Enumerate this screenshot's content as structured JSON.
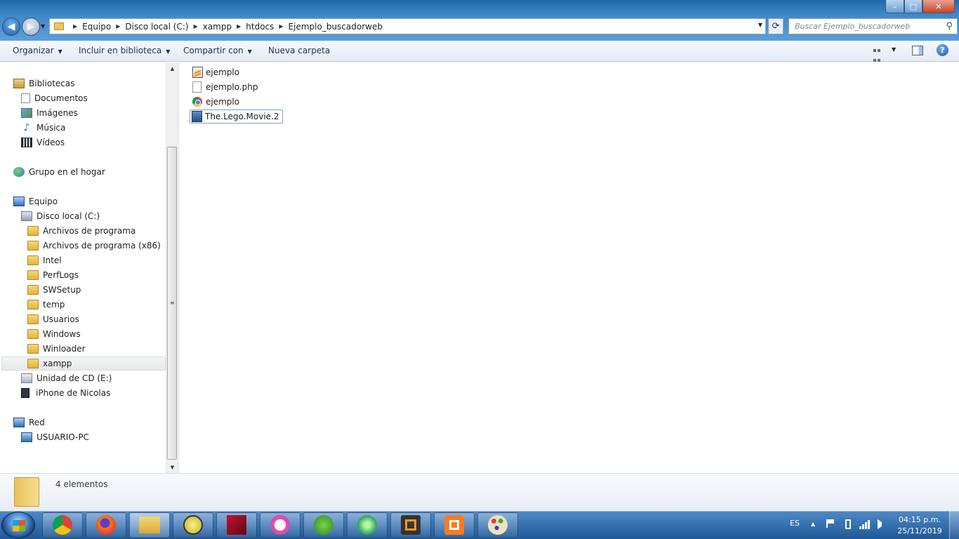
{
  "window": {
    "minimize": "–",
    "maximize": "□",
    "close": "✕"
  },
  "address": {
    "crumbs": [
      "Equipo",
      "Disco local (C:)",
      "xampp",
      "htdocs",
      "Ejemplo_buscadorweb"
    ]
  },
  "search": {
    "placeholder": "Buscar Ejemplo_buscadorweb"
  },
  "toolbar": {
    "organize": "Organizar",
    "include_library": "Incluir en biblioteca",
    "share": "Compartir con",
    "new_folder": "Nueva carpeta"
  },
  "nav": {
    "libraries": "Bibliotecas",
    "documents": "Documentos",
    "images": "Imágenes",
    "music": "Música",
    "videos": "Vídeos",
    "homegroup": "Grupo en el hogar",
    "computer": "Equipo",
    "local_disk": "Disco local (C:)",
    "folders": [
      "Archivos de programa",
      "Archivos de programa (x86)",
      "Intel",
      "PerfLogs",
      "SWSetup",
      "temp",
      "Usuarios",
      "Windows",
      "Winloader",
      "xampp"
    ],
    "cd_drive": "Unidad de CD (E:)",
    "iphone": "iPhone de Nicolas",
    "network": "Red",
    "network_pc": "USUARIO-PC"
  },
  "files": [
    {
      "name": "ejemplo",
      "icon": "sublime-file-icon"
    },
    {
      "name": "ejemplo.php",
      "icon": "blank-file-icon"
    },
    {
      "name": "ejemplo",
      "icon": "chrome-html-icon"
    },
    {
      "name": "The.Lego.Movie.2",
      "icon": "movie-file-icon"
    }
  ],
  "details": {
    "count": "4 elementos"
  },
  "taskbar": {
    "apps": [
      "chrome",
      "firefox",
      "explorer",
      "ace-utilities",
      "security-app",
      "itunes",
      "utorrent",
      "atom",
      "sublime-text",
      "xampp",
      "paint"
    ],
    "lang": "ES",
    "time": "04:15 p.m.",
    "date": "25/11/2019"
  },
  "colors": {
    "titlebar": "#3f88c8",
    "taskbar": "#1f5896",
    "selection_border": "#7da2ce"
  }
}
